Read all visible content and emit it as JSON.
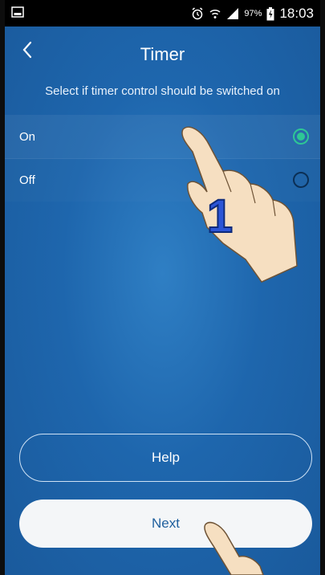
{
  "status_bar": {
    "battery_percent": "97%",
    "time": "18:03",
    "icons": [
      "image-icon",
      "alarm-icon",
      "wifi-icon",
      "signal-icon",
      "battery-icon"
    ]
  },
  "header": {
    "title": "Timer",
    "back_icon": "chevron-left-icon"
  },
  "subtitle": "Select if timer control should be switched on",
  "options": [
    {
      "label": "On",
      "selected": true
    },
    {
      "label": "Off",
      "selected": false
    }
  ],
  "overlay": {
    "step_number": "1"
  },
  "buttons": {
    "help": "Help",
    "next": "Next"
  },
  "colors": {
    "background": "#1e66ad",
    "radio_selected": "#2ec795",
    "next_button_text": "#1f5f9e"
  }
}
